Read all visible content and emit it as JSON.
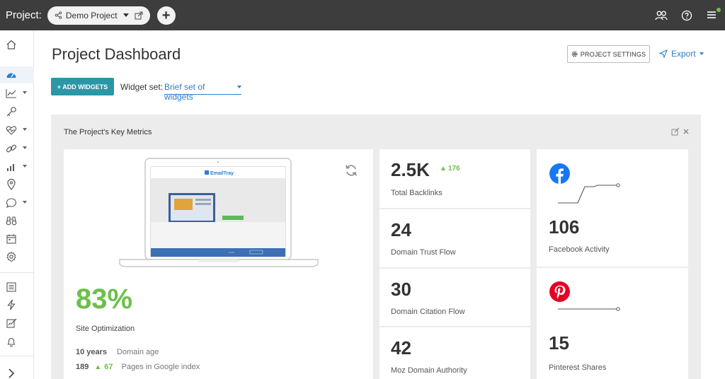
{
  "topbar": {
    "project_label": "Project:",
    "project_name": "Demo Project",
    "add_label": "+"
  },
  "header": {
    "title": "Project Dashboard",
    "settings_label": "PROJECT SETTINGS",
    "export_label": "Export"
  },
  "toolbar": {
    "add_widgets_label": "+ ADD WIDGETS",
    "widget_set_label": "Widget set:",
    "widget_set_value": "Brief set of widgets"
  },
  "panel": {
    "title": "The Project's Key Metrics"
  },
  "site": {
    "preview_brand": "EmailTray",
    "optimization_value": "83%",
    "optimization_label": "Site Optimization",
    "domain_age_value": "10 years",
    "domain_age_label": "Domain age",
    "indexed_value": "189",
    "indexed_delta": "67",
    "indexed_label": "Pages in Google index"
  },
  "metrics": [
    {
      "value": "2.5K",
      "delta": "176",
      "label": "Total Backlinks"
    },
    {
      "value": "24",
      "label": "Domain Trust Flow"
    },
    {
      "value": "30",
      "label": "Domain Citation Flow"
    },
    {
      "value": "42",
      "label": "Moz Domain Authority"
    }
  ],
  "social": [
    {
      "icon": "facebook-icon",
      "value": "106",
      "label": "Facebook Activity"
    },
    {
      "icon": "pinterest-icon",
      "value": "15",
      "label": "Pinterest Shares"
    }
  ],
  "colors": {
    "topbar": "#3d3d3d",
    "accent": "#2b96a6",
    "link": "#2a7fcf",
    "positive": "#6cc04a",
    "facebook": "#1877f2",
    "pinterest": "#e60023"
  }
}
